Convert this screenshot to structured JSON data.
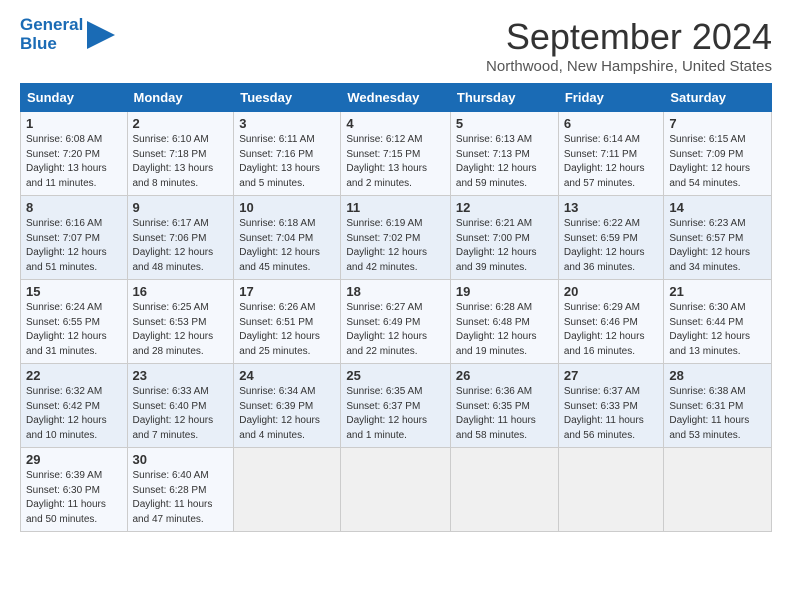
{
  "header": {
    "logo_line1": "General",
    "logo_line2": "Blue",
    "month_title": "September 2024",
    "location": "Northwood, New Hampshire, United States"
  },
  "days_of_week": [
    "Sunday",
    "Monday",
    "Tuesday",
    "Wednesday",
    "Thursday",
    "Friday",
    "Saturday"
  ],
  "weeks": [
    [
      {
        "day": "1",
        "info": "Sunrise: 6:08 AM\nSunset: 7:20 PM\nDaylight: 13 hours\nand 11 minutes."
      },
      {
        "day": "2",
        "info": "Sunrise: 6:10 AM\nSunset: 7:18 PM\nDaylight: 13 hours\nand 8 minutes."
      },
      {
        "day": "3",
        "info": "Sunrise: 6:11 AM\nSunset: 7:16 PM\nDaylight: 13 hours\nand 5 minutes."
      },
      {
        "day": "4",
        "info": "Sunrise: 6:12 AM\nSunset: 7:15 PM\nDaylight: 13 hours\nand 2 minutes."
      },
      {
        "day": "5",
        "info": "Sunrise: 6:13 AM\nSunset: 7:13 PM\nDaylight: 12 hours\nand 59 minutes."
      },
      {
        "day": "6",
        "info": "Sunrise: 6:14 AM\nSunset: 7:11 PM\nDaylight: 12 hours\nand 57 minutes."
      },
      {
        "day": "7",
        "info": "Sunrise: 6:15 AM\nSunset: 7:09 PM\nDaylight: 12 hours\nand 54 minutes."
      }
    ],
    [
      {
        "day": "8",
        "info": "Sunrise: 6:16 AM\nSunset: 7:07 PM\nDaylight: 12 hours\nand 51 minutes."
      },
      {
        "day": "9",
        "info": "Sunrise: 6:17 AM\nSunset: 7:06 PM\nDaylight: 12 hours\nand 48 minutes."
      },
      {
        "day": "10",
        "info": "Sunrise: 6:18 AM\nSunset: 7:04 PM\nDaylight: 12 hours\nand 45 minutes."
      },
      {
        "day": "11",
        "info": "Sunrise: 6:19 AM\nSunset: 7:02 PM\nDaylight: 12 hours\nand 42 minutes."
      },
      {
        "day": "12",
        "info": "Sunrise: 6:21 AM\nSunset: 7:00 PM\nDaylight: 12 hours\nand 39 minutes."
      },
      {
        "day": "13",
        "info": "Sunrise: 6:22 AM\nSunset: 6:59 PM\nDaylight: 12 hours\nand 36 minutes."
      },
      {
        "day": "14",
        "info": "Sunrise: 6:23 AM\nSunset: 6:57 PM\nDaylight: 12 hours\nand 34 minutes."
      }
    ],
    [
      {
        "day": "15",
        "info": "Sunrise: 6:24 AM\nSunset: 6:55 PM\nDaylight: 12 hours\nand 31 minutes."
      },
      {
        "day": "16",
        "info": "Sunrise: 6:25 AM\nSunset: 6:53 PM\nDaylight: 12 hours\nand 28 minutes."
      },
      {
        "day": "17",
        "info": "Sunrise: 6:26 AM\nSunset: 6:51 PM\nDaylight: 12 hours\nand 25 minutes."
      },
      {
        "day": "18",
        "info": "Sunrise: 6:27 AM\nSunset: 6:49 PM\nDaylight: 12 hours\nand 22 minutes."
      },
      {
        "day": "19",
        "info": "Sunrise: 6:28 AM\nSunset: 6:48 PM\nDaylight: 12 hours\nand 19 minutes."
      },
      {
        "day": "20",
        "info": "Sunrise: 6:29 AM\nSunset: 6:46 PM\nDaylight: 12 hours\nand 16 minutes."
      },
      {
        "day": "21",
        "info": "Sunrise: 6:30 AM\nSunset: 6:44 PM\nDaylight: 12 hours\nand 13 minutes."
      }
    ],
    [
      {
        "day": "22",
        "info": "Sunrise: 6:32 AM\nSunset: 6:42 PM\nDaylight: 12 hours\nand 10 minutes."
      },
      {
        "day": "23",
        "info": "Sunrise: 6:33 AM\nSunset: 6:40 PM\nDaylight: 12 hours\nand 7 minutes."
      },
      {
        "day": "24",
        "info": "Sunrise: 6:34 AM\nSunset: 6:39 PM\nDaylight: 12 hours\nand 4 minutes."
      },
      {
        "day": "25",
        "info": "Sunrise: 6:35 AM\nSunset: 6:37 PM\nDaylight: 12 hours\nand 1 minute."
      },
      {
        "day": "26",
        "info": "Sunrise: 6:36 AM\nSunset: 6:35 PM\nDaylight: 11 hours\nand 58 minutes."
      },
      {
        "day": "27",
        "info": "Sunrise: 6:37 AM\nSunset: 6:33 PM\nDaylight: 11 hours\nand 56 minutes."
      },
      {
        "day": "28",
        "info": "Sunrise: 6:38 AM\nSunset: 6:31 PM\nDaylight: 11 hours\nand 53 minutes."
      }
    ],
    [
      {
        "day": "29",
        "info": "Sunrise: 6:39 AM\nSunset: 6:30 PM\nDaylight: 11 hours\nand 50 minutes."
      },
      {
        "day": "30",
        "info": "Sunrise: 6:40 AM\nSunset: 6:28 PM\nDaylight: 11 hours\nand 47 minutes."
      },
      {
        "day": "",
        "info": ""
      },
      {
        "day": "",
        "info": ""
      },
      {
        "day": "",
        "info": ""
      },
      {
        "day": "",
        "info": ""
      },
      {
        "day": "",
        "info": ""
      }
    ]
  ]
}
